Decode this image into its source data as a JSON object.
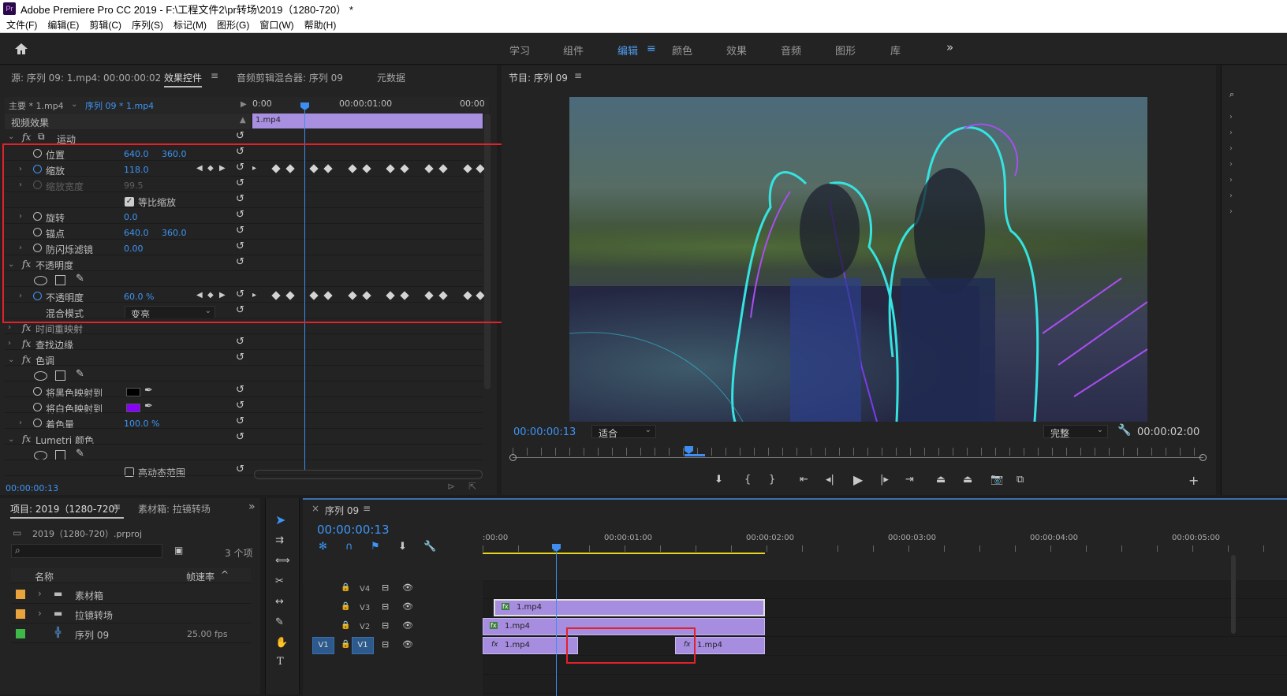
{
  "window": {
    "title": "Adobe Premiere Pro CC 2019 - F:\\工程文件2\\pr转场\\2019（1280-720） *",
    "app_badge": "Pr"
  },
  "menu": [
    "文件(F)",
    "编辑(E)",
    "剪辑(C)",
    "序列(S)",
    "标记(M)",
    "图形(G)",
    "窗口(W)",
    "帮助(H)"
  ],
  "workspaces": {
    "items": [
      "学习",
      "组件",
      "编辑",
      "颜色",
      "效果",
      "音频",
      "图形",
      "库"
    ],
    "active": "编辑",
    "more": "»"
  },
  "source_panel": {
    "tabs": [
      "源: 序列 09: 1.mp4: 00:00:00:02",
      "效果控件",
      "音频剪辑混合器: 序列 09",
      "元数据"
    ],
    "master": "主要 * 1.mp4",
    "sequence": "序列 09 * 1.mp4",
    "ruler": [
      "0:00",
      "00:00:01:00",
      "00:00"
    ],
    "clip_label": "1.mp4",
    "section": "视频效果",
    "timecode": "00:00:00:13",
    "effects": [
      {
        "name": "运动",
        "fx": "fx"
      },
      {
        "name": "位置",
        "v1": "640.0",
        "v2": "360.0"
      },
      {
        "name": "缩放",
        "v1": "118.0"
      },
      {
        "name": "缩放宽度",
        "v1": "99.5"
      },
      {
        "name": "等比缩放"
      },
      {
        "name": "旋转",
        "v1": "0.0"
      },
      {
        "name": "锚点",
        "v1": "640.0",
        "v2": "360.0"
      },
      {
        "name": "防闪烁滤镜",
        "v1": "0.00"
      },
      {
        "name": "不透明度",
        "fx": "fx"
      },
      {
        "name": "不透明度",
        "v1": "60.0 %"
      },
      {
        "name": "混合模式",
        "v1": "变亮"
      },
      {
        "name": "时间重映射",
        "fx": "fx"
      },
      {
        "name": "查找边缘",
        "fx": "fx"
      },
      {
        "name": "色调",
        "fx": "fx"
      },
      {
        "name": "将黑色映射到"
      },
      {
        "name": "将白色映射到"
      },
      {
        "name": "着色量",
        "v1": "100.0 %"
      },
      {
        "name": "Lumetri 颜色",
        "fx": "fx"
      },
      {
        "name": "高动态范围"
      }
    ],
    "colors": {
      "black_swatch": "#000000",
      "white_map_swatch": "#8a00ff"
    }
  },
  "program_panel": {
    "title": "节目: 序列 09",
    "timecode": "00:00:00:13",
    "fit": "适合",
    "quality": "完整",
    "duration": "00:00:02:00"
  },
  "project_panel": {
    "tabs": [
      "项目: 2019（1280-720）",
      "素材箱: 拉镜转场"
    ],
    "file": "2019（1280-720）.prproj",
    "count": "3 个项",
    "col_name": "名称",
    "col_rate": "帧速率",
    "items": [
      {
        "name": "素材箱",
        "color": "#e8a33d",
        "rate": ""
      },
      {
        "name": "拉镜转场",
        "color": "#e8a33d",
        "rate": ""
      },
      {
        "name": "序列 09",
        "color": "#3fb84a",
        "rate": "25.00 fps"
      }
    ]
  },
  "timeline_panel": {
    "title": "序列 09",
    "timecode": "00:00:00:13",
    "ruler": [
      ":00:00",
      "00:00:01:00",
      "00:00:02:00",
      "00:00:03:00",
      "00:00:04:00",
      "00:00:05:00"
    ],
    "tracks": [
      "V4",
      "V3",
      "V2",
      "V1"
    ],
    "source_patch": "V1",
    "clips": [
      {
        "track": "V3",
        "label": "1.mp4",
        "fx": "fx"
      },
      {
        "track": "V2",
        "label": "1.mp4",
        "fx": "fx"
      },
      {
        "track": "V1",
        "label": "1.mp4",
        "fx": "fx"
      },
      {
        "track": "V1",
        "label": "1.mp4",
        "fx": "fx"
      }
    ]
  }
}
